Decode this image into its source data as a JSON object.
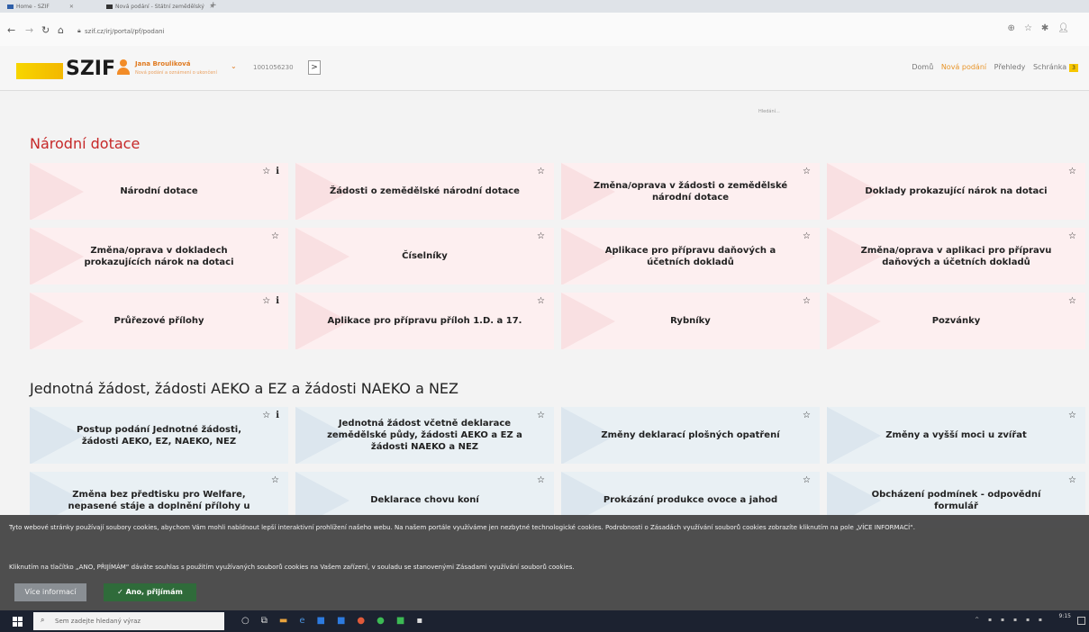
{
  "browser": {
    "tabs": [
      {
        "title": "Home - SZIF"
      },
      {
        "title": "Nová podání - Státní zemědělský"
      }
    ],
    "url": "szif.cz/irj/portal/pf/podani"
  },
  "header": {
    "logo": "SZIF",
    "user_name": "Jana Brouliková",
    "user_subtitle": "Nová podání a oznámení o ukončení",
    "user_id": "1001056230",
    "nav": [
      {
        "label": "Domů"
      },
      {
        "label": "Nová podání"
      },
      {
        "label": "Přehledy"
      },
      {
        "label": "Schránka"
      }
    ],
    "inbox_badge": "3"
  },
  "search": {
    "label": "Hledání..."
  },
  "sections": [
    {
      "title": "Národní dotace",
      "tiles": [
        {
          "label": "Národní dotace"
        },
        {
          "label": "Žádosti o zemědělské národní dotace"
        },
        {
          "label": "Změna/oprava v žádosti o zemědělské národní dotace"
        },
        {
          "label": "Doklady prokazující nárok na dotaci"
        },
        {
          "label": "Změna/oprava v dokladech prokazujících nárok na dotaci"
        },
        {
          "label": "Číselníky"
        },
        {
          "label": "Aplikace pro přípravu daňových a účetních dokladů"
        },
        {
          "label": "Změna/oprava v aplikaci pro přípravu daňových a účetních dokladů"
        },
        {
          "label": "Průřezové přílohy"
        },
        {
          "label": "Aplikace pro přípravu příloh 1.D. a 17."
        },
        {
          "label": "Rybníky"
        },
        {
          "label": "Pozvánky"
        }
      ]
    },
    {
      "title": "Jednotná žádost, žádosti AEKO a EZ a žádosti NAEKO a NEZ",
      "tiles": [
        {
          "label": "Postup podání Jednotné žádosti, žádosti AEKO, EZ, NAEKO, NEZ"
        },
        {
          "label": "Jednotná žádost včetně deklarace zemědělské půdy, žádosti AEKO a EZ a žádosti NAEKO a NEZ"
        },
        {
          "label": "Změny deklarací plošných opatření"
        },
        {
          "label": "Změny a vyšší moci u zvířat"
        },
        {
          "label": "Změna bez předtisku pro Welfare, nepasené stáje a doplnění přílohy u"
        },
        {
          "label": "Deklarace chovu koní"
        },
        {
          "label": "Prokázání produkce ovoce a jahod"
        },
        {
          "label": "Obcházení podmínek - odpovědní formulář"
        }
      ]
    }
  ],
  "cookie": {
    "text1": "Tyto webové stránky používají soubory cookies, abychom Vám mohli nabídnout lepší interaktivní prohlížení našeho webu. Na našem portále využíváme jen nezbytné technologické cookies. Podrobnosti o Zásadách využívání souborů cookies zobrazíte kliknutím na pole „VÍCE INFORMACÍ“.",
    "text2": "Kliknutím na tlačítko „ANO, PŘIJÍMÁM“ dáváte souhlas s použitím využívaných souborů cookies na Vašem zařízení, v souladu se stanovenými Zásadami využívání souborů cookies.",
    "more_label": "Více informací",
    "accept_label": "Ano, přijímám"
  },
  "taskbar": {
    "search_placeholder": "Sem zadejte hledaný výraz",
    "time": "9:15"
  }
}
